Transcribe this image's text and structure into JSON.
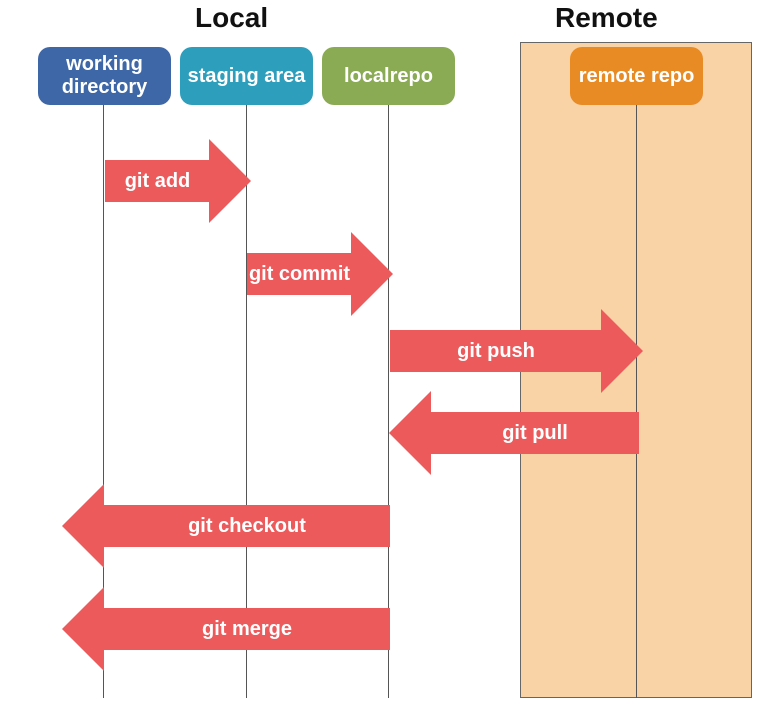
{
  "headers": {
    "local": "Local",
    "remote": "Remote"
  },
  "nodes": {
    "working_directory": "working directory",
    "staging_area": "staging area",
    "local_repo": "localrepo",
    "remote_repo": "remote repo"
  },
  "arrows": {
    "git_add": "git add",
    "git_commit": "git commit",
    "git_push": "git push",
    "git_pull": "git pull",
    "git_checkout": "git checkout",
    "git_merge": "git merge"
  },
  "colors": {
    "working_directory": "#3e67a7",
    "staging_area": "#2e9ebd",
    "local_repo": "#8aab53",
    "remote_repo": "#e98b24",
    "arrow": "#ec5a5b",
    "remote_bg": "#f9d2a6"
  },
  "chart_data": {
    "type": "diagram",
    "title": "Git Workflow Diagram",
    "groups": [
      {
        "name": "Local",
        "lanes": [
          "working directory",
          "staging area",
          "localrepo"
        ]
      },
      {
        "name": "Remote",
        "lanes": [
          "remote repo"
        ]
      }
    ],
    "lanes": [
      {
        "id": "working_directory",
        "label": "working directory",
        "group": "Local"
      },
      {
        "id": "staging_area",
        "label": "staging area",
        "group": "Local"
      },
      {
        "id": "local_repo",
        "label": "localrepo",
        "group": "Local"
      },
      {
        "id": "remote_repo",
        "label": "remote repo",
        "group": "Remote"
      }
    ],
    "flows": [
      {
        "label": "git add",
        "from": "working_directory",
        "to": "staging_area",
        "direction": "right"
      },
      {
        "label": "git commit",
        "from": "staging_area",
        "to": "local_repo",
        "direction": "right"
      },
      {
        "label": "git push",
        "from": "local_repo",
        "to": "remote_repo",
        "direction": "right"
      },
      {
        "label": "git pull",
        "from": "remote_repo",
        "to": "local_repo",
        "direction": "left"
      },
      {
        "label": "git checkout",
        "from": "local_repo",
        "to": "working_directory",
        "direction": "left"
      },
      {
        "label": "git merge",
        "from": "local_repo",
        "to": "working_directory",
        "direction": "left"
      }
    ]
  }
}
